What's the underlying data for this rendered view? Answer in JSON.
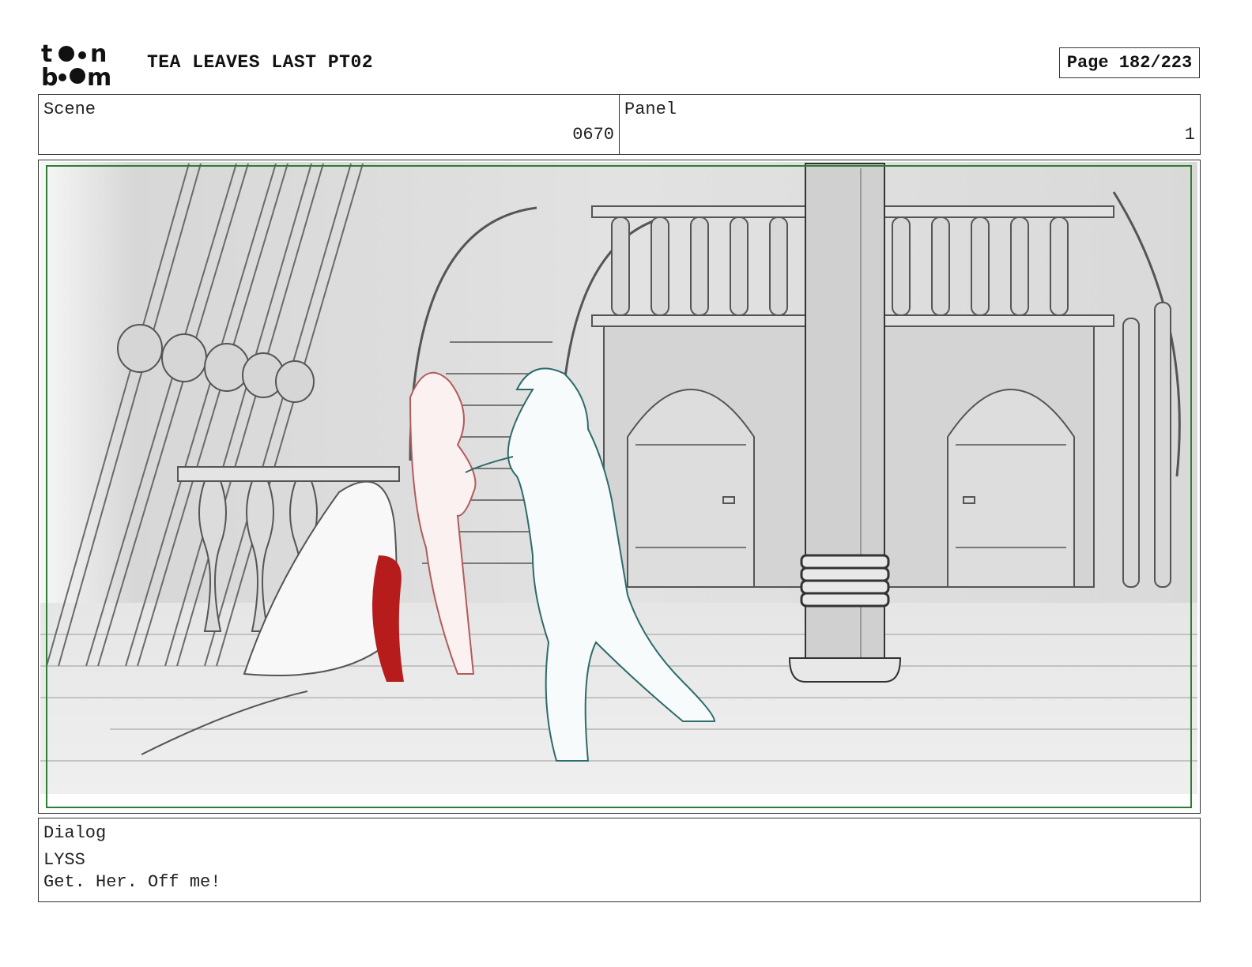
{
  "header": {
    "logo_icon": "toon-boom-logo",
    "project_title": "TEA LEAVES LAST PT02",
    "page_indicator": "Page 182/223"
  },
  "scene": {
    "label": "Scene",
    "value": "0670"
  },
  "panel": {
    "label": "Panel",
    "value": "1"
  },
  "artwork": {
    "icon": "storyboard-sketch-ship-deck",
    "safe_frame_color": "#2e7d32",
    "blood_color": "#b71c1c",
    "character_line_color": "#2e6b6b"
  },
  "dialog": {
    "label": "Dialog",
    "character": "LYSS",
    "line": "Get. Her. Off me!"
  }
}
